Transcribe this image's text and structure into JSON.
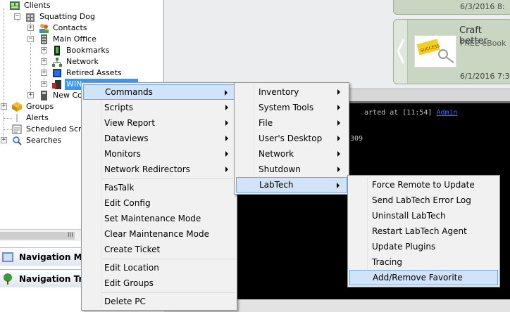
{
  "tree": {
    "items": [
      {
        "label": "Clients"
      },
      {
        "label": "Squatting Dog"
      },
      {
        "label": "Contacts"
      },
      {
        "label": "Main Office"
      },
      {
        "label": "Bookmarks"
      },
      {
        "label": "Network"
      },
      {
        "label": "Retired Assets"
      },
      {
        "label": "WIN"
      },
      {
        "label": "New Cor"
      },
      {
        "label": "Groups"
      },
      {
        "label": "Alerts"
      },
      {
        "label": "Scheduled Script"
      },
      {
        "label": "Searches"
      }
    ],
    "expander_plus": "+",
    "expander_minus": "−",
    "scroll_grip": "III"
  },
  "nav": {
    "menu_label": "Navigation Menu",
    "tree_label": "Navigation Tree"
  },
  "feed": {
    "card1_date": "6/3/2016 8:",
    "card2_title": "Craft better",
    "card2_sub": "FREE eBook",
    "card2_date": "6/1/2016 7:3",
    "thumb_text": "SUCCESS"
  },
  "console": {
    "line1_text": "arted at [11:54] ",
    "line1_link": "Admin",
    "line2_text": "309"
  },
  "context_menu": {
    "items": [
      {
        "label": "Commands"
      },
      {
        "label": "Scripts"
      },
      {
        "label": "View Report"
      },
      {
        "label": "Dataviews"
      },
      {
        "label": "Monitors"
      },
      {
        "label": "Network Redirectors"
      },
      {
        "label": "FasTalk"
      },
      {
        "label": "Edit Config"
      },
      {
        "label": "Set Maintenance Mode"
      },
      {
        "label": "Clear Maintenance Mode"
      },
      {
        "label": "Create Ticket"
      },
      {
        "label": "Edit Location"
      },
      {
        "label": "Edit Groups"
      },
      {
        "label": "Delete PC"
      }
    ]
  },
  "commands_menu": {
    "items": [
      {
        "label": "Inventory"
      },
      {
        "label": "System Tools"
      },
      {
        "label": "File"
      },
      {
        "label": "User's Desktop"
      },
      {
        "label": "Network"
      },
      {
        "label": "Shutdown"
      },
      {
        "label": "LabTech"
      }
    ]
  },
  "labtech_menu": {
    "items": [
      {
        "label": "Force Remote to Update"
      },
      {
        "label": "Send LabTech Error Log"
      },
      {
        "label": "Uninstall LabTech"
      },
      {
        "label": "Restart LabTech Agent"
      },
      {
        "label": "Update Plugins"
      },
      {
        "label": "Tracing"
      },
      {
        "label": "Add/Remove Favorite"
      }
    ]
  },
  "colors": {
    "selection": "#3399ff",
    "menu_highlight": "#d1e3f8",
    "feed_card": "#c9d7c2",
    "console_bg": "#000000"
  }
}
